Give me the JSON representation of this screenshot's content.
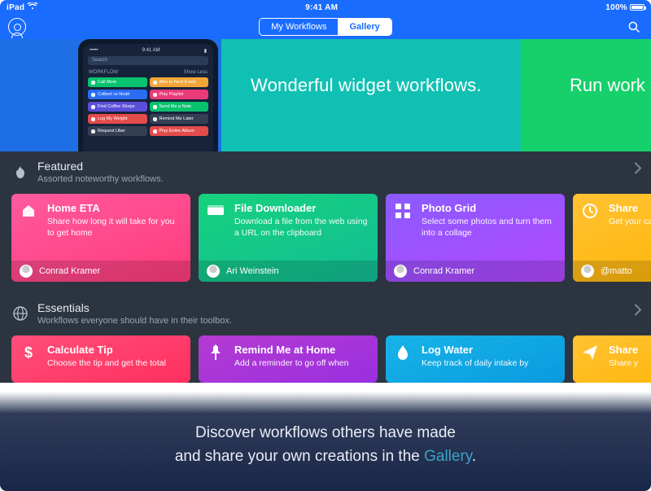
{
  "status": {
    "device": "iPad",
    "time": "9:41 AM",
    "battery_pct": "100%"
  },
  "nav": {
    "tabs": {
      "left": "My Workflows",
      "right": "Gallery",
      "active": "Gallery"
    }
  },
  "hero": {
    "headline": "Wonderful widget workflows.",
    "headline2": "Run work",
    "phone": {
      "time": "9:41 AM",
      "search": "Search",
      "section": "WORKFLOW",
      "show": "Show Less",
      "chips": [
        {
          "label": "Call Mom",
          "color": "c-green"
        },
        {
          "label": "Bike to Next Event",
          "color": "c-amber"
        },
        {
          "label": "Colbert vs Noah",
          "color": "c-blue"
        },
        {
          "label": "Play Playlist",
          "color": "c-pink"
        },
        {
          "label": "Find Coffee Shops",
          "color": "c-indigo"
        },
        {
          "label": "Send Me a Note",
          "color": "c-green"
        },
        {
          "label": "Log My Weight",
          "color": "c-red"
        },
        {
          "label": "Remind Me Later",
          "color": "c-slate"
        },
        {
          "label": "Request Uber",
          "color": "c-slate"
        },
        {
          "label": "Play Entire Album",
          "color": "c-red"
        }
      ]
    }
  },
  "featured": {
    "title": "Featured",
    "subtitle": "Assorted noteworthy workflows.",
    "items": [
      {
        "icon": "home",
        "title": "Home ETA",
        "subtitle": "Share how long it will take for you to get home",
        "author": "Conrad Kramer",
        "grad": "g-pink"
      },
      {
        "icon": "drive",
        "title": "File Downloader",
        "subtitle": "Download a file from the web using a URL on the clipboard",
        "author": "Ari Weinstein",
        "grad": "g-green"
      },
      {
        "icon": "grid",
        "title": "Photo Grid",
        "subtitle": "Select some photos and turn them into a collage",
        "author": "Conrad Kramer",
        "grad": "g-purple"
      },
      {
        "icon": "clock",
        "title": "Share",
        "subtitle": "Get your calendar",
        "author": "@matto",
        "grad": "g-yellow"
      }
    ]
  },
  "essentials": {
    "title": "Essentials",
    "subtitle": "Workflows everyone should have in their toolbox.",
    "items": [
      {
        "icon": "dollar",
        "title": "Calculate Tip",
        "subtitle": "Choose the tip and get the total",
        "grad": "g-redpink"
      },
      {
        "icon": "pin",
        "title": "Remind Me at Home",
        "subtitle": "Add a reminder to go off when",
        "grad": "g-magenta"
      },
      {
        "icon": "drop",
        "title": "Log Water",
        "subtitle": "Keep track of daily intake by",
        "grad": "g-cyan"
      },
      {
        "icon": "send",
        "title": "Share",
        "subtitle": "Share y",
        "grad": "g-amber"
      }
    ]
  },
  "footer": {
    "line1": "Discover workflows others have made",
    "line2a": "and share your own creations in the ",
    "line2b": "Gallery",
    "line2c": "."
  }
}
